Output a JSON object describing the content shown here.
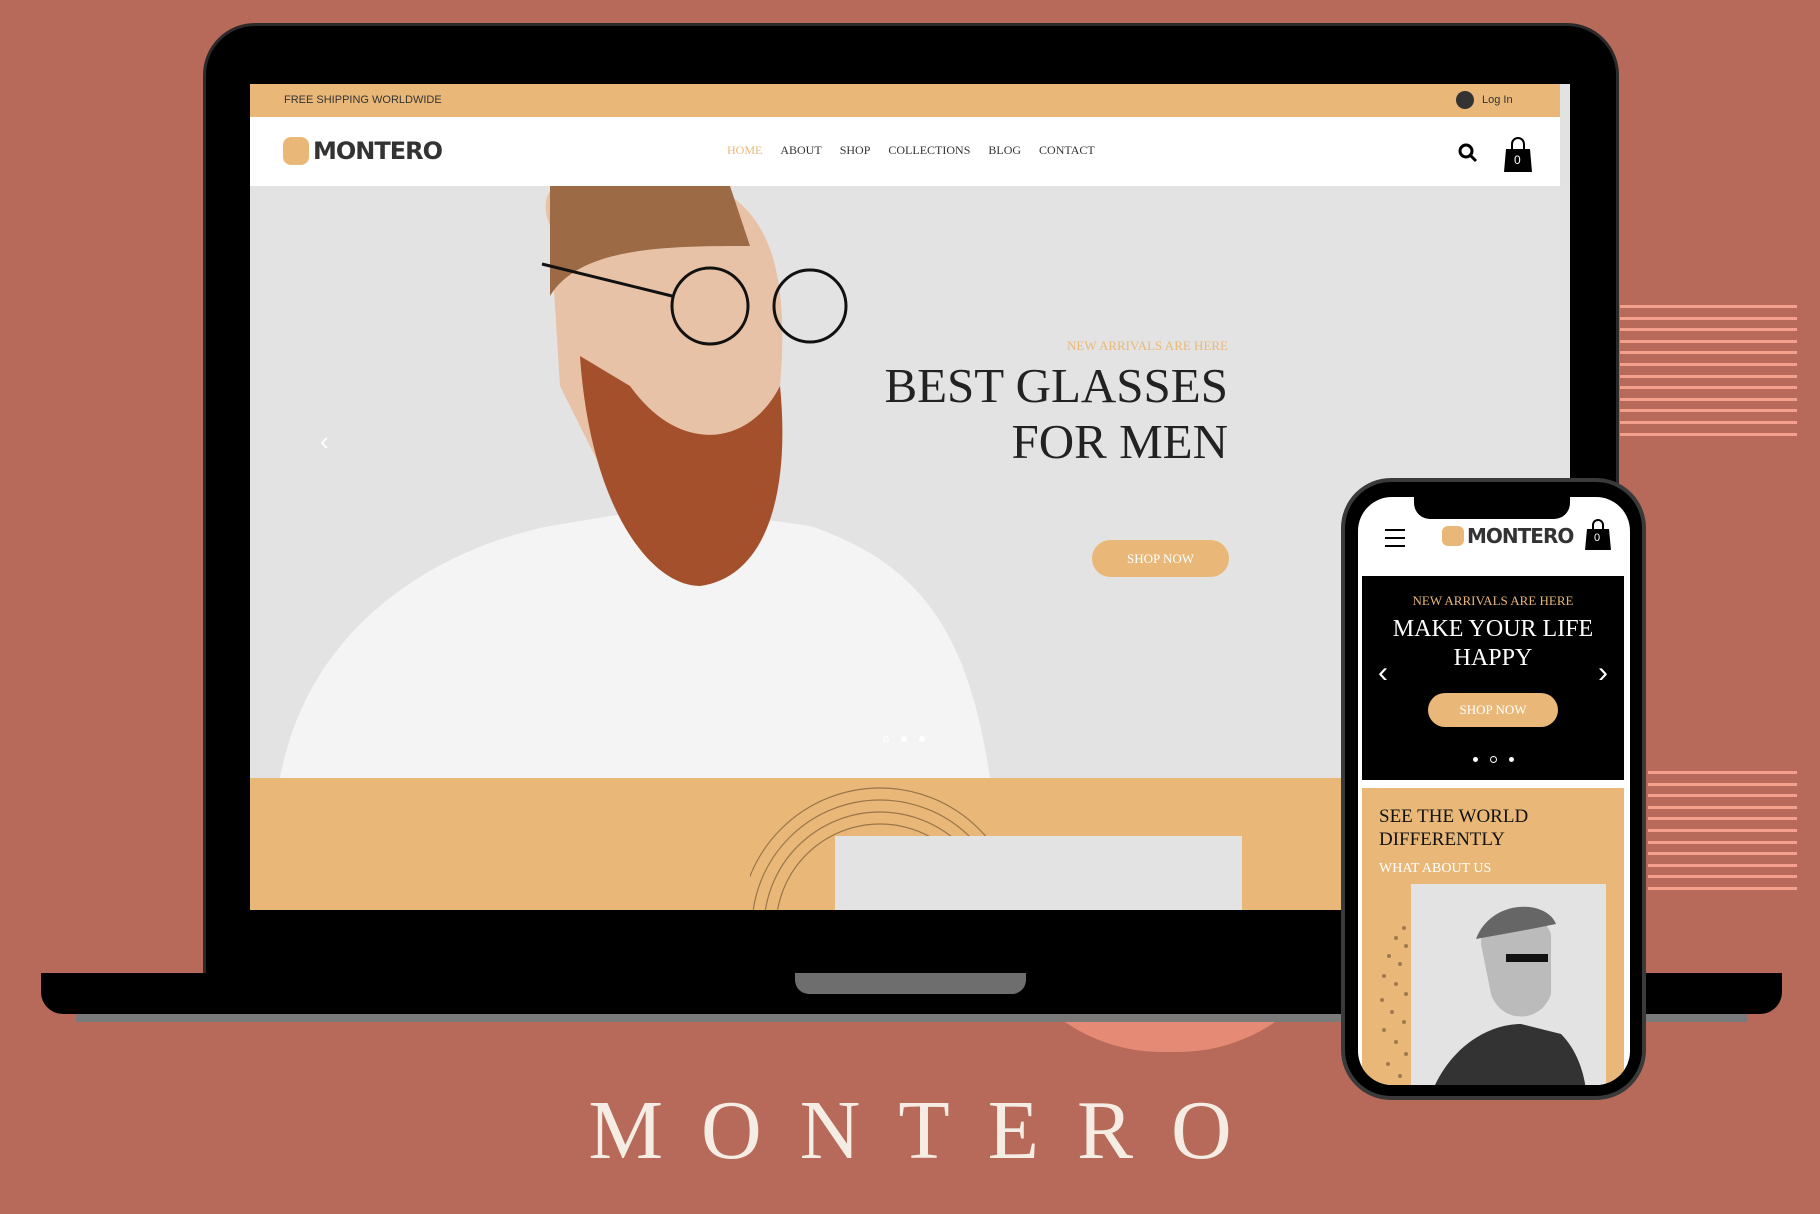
{
  "colors": {
    "background": "#b86a5a",
    "accent": "#e9b878",
    "stripes": "#f4a08c"
  },
  "desktop": {
    "topbar": {
      "shipping": "FREE SHIPPING WORLDWIDE",
      "login": "Log In",
      "login_icon": "user-avatar-icon"
    },
    "logo": "MONTERO",
    "nav": [
      "HOME",
      "ABOUT",
      "SHOP",
      "COLLECTIONS",
      "BLOG",
      "CONTACT"
    ],
    "active_nav": "HOME",
    "cart_count": "0",
    "hero": {
      "eyebrow": "NEW ARRIVALS ARE HERE",
      "title_line1": "BEST GLASSES",
      "title_line2": "FOR MEN",
      "cta": "SHOP NOW",
      "slides": 3,
      "active_slide": 2
    }
  },
  "mobile": {
    "logo": "MONTERO",
    "cart_count": "0",
    "banner": {
      "eyebrow": "NEW ARRIVALS ARE HERE",
      "title_line1": "MAKE YOUR LIFE",
      "title_line2": "HAPPY",
      "cta": "SHOP NOW",
      "slides": 3,
      "active_slide": 2
    },
    "about": {
      "title_line1": "SEE THE WORLD",
      "title_line2": "DIFFERENTLY",
      "subtitle": "WHAT ABOUT US"
    }
  },
  "brand_wordmark": "MONTERO"
}
